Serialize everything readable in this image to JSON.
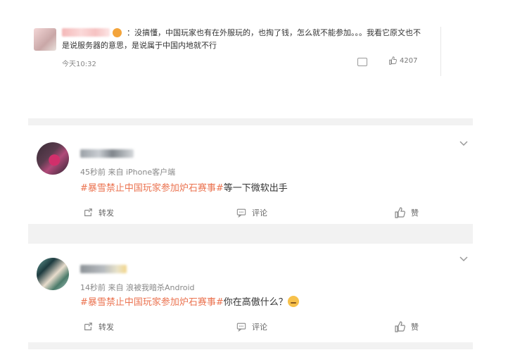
{
  "top_comment": {
    "text": "：没搞懂，中国玩家也有在外服玩的，也掏了钱，怎么就不能参加。。。我看它原文也不是说服务器的意思，是说属于中国内地就不行",
    "time": "今天10:32",
    "like_count": "4207"
  },
  "posts": [
    {
      "meta": "45秒前 来自 iPhone客户端",
      "hashtag": "#暴雪禁止中国玩家参加炉石赛事#",
      "text": "等一下微软出手",
      "actions": {
        "repost": "转发",
        "comment": "评论",
        "like": "赞"
      }
    },
    {
      "meta": "14秒前 来自 浪被我暗杀Android",
      "hashtag": "#暴雪禁止中国玩家参加炉石赛事#",
      "text": "你在高傲什么？",
      "actions": {
        "repost": "转发",
        "comment": "评论",
        "like": "赞"
      }
    }
  ],
  "icons": {
    "chevron": "chevron-down-icon",
    "repost": "repost-icon",
    "comment": "comment-icon",
    "like": "thumbs-up-icon",
    "reply": "reply-icon"
  },
  "colors": {
    "hashtag": "#eb7350",
    "meta": "#888888",
    "separator": "#f2f2f2"
  }
}
